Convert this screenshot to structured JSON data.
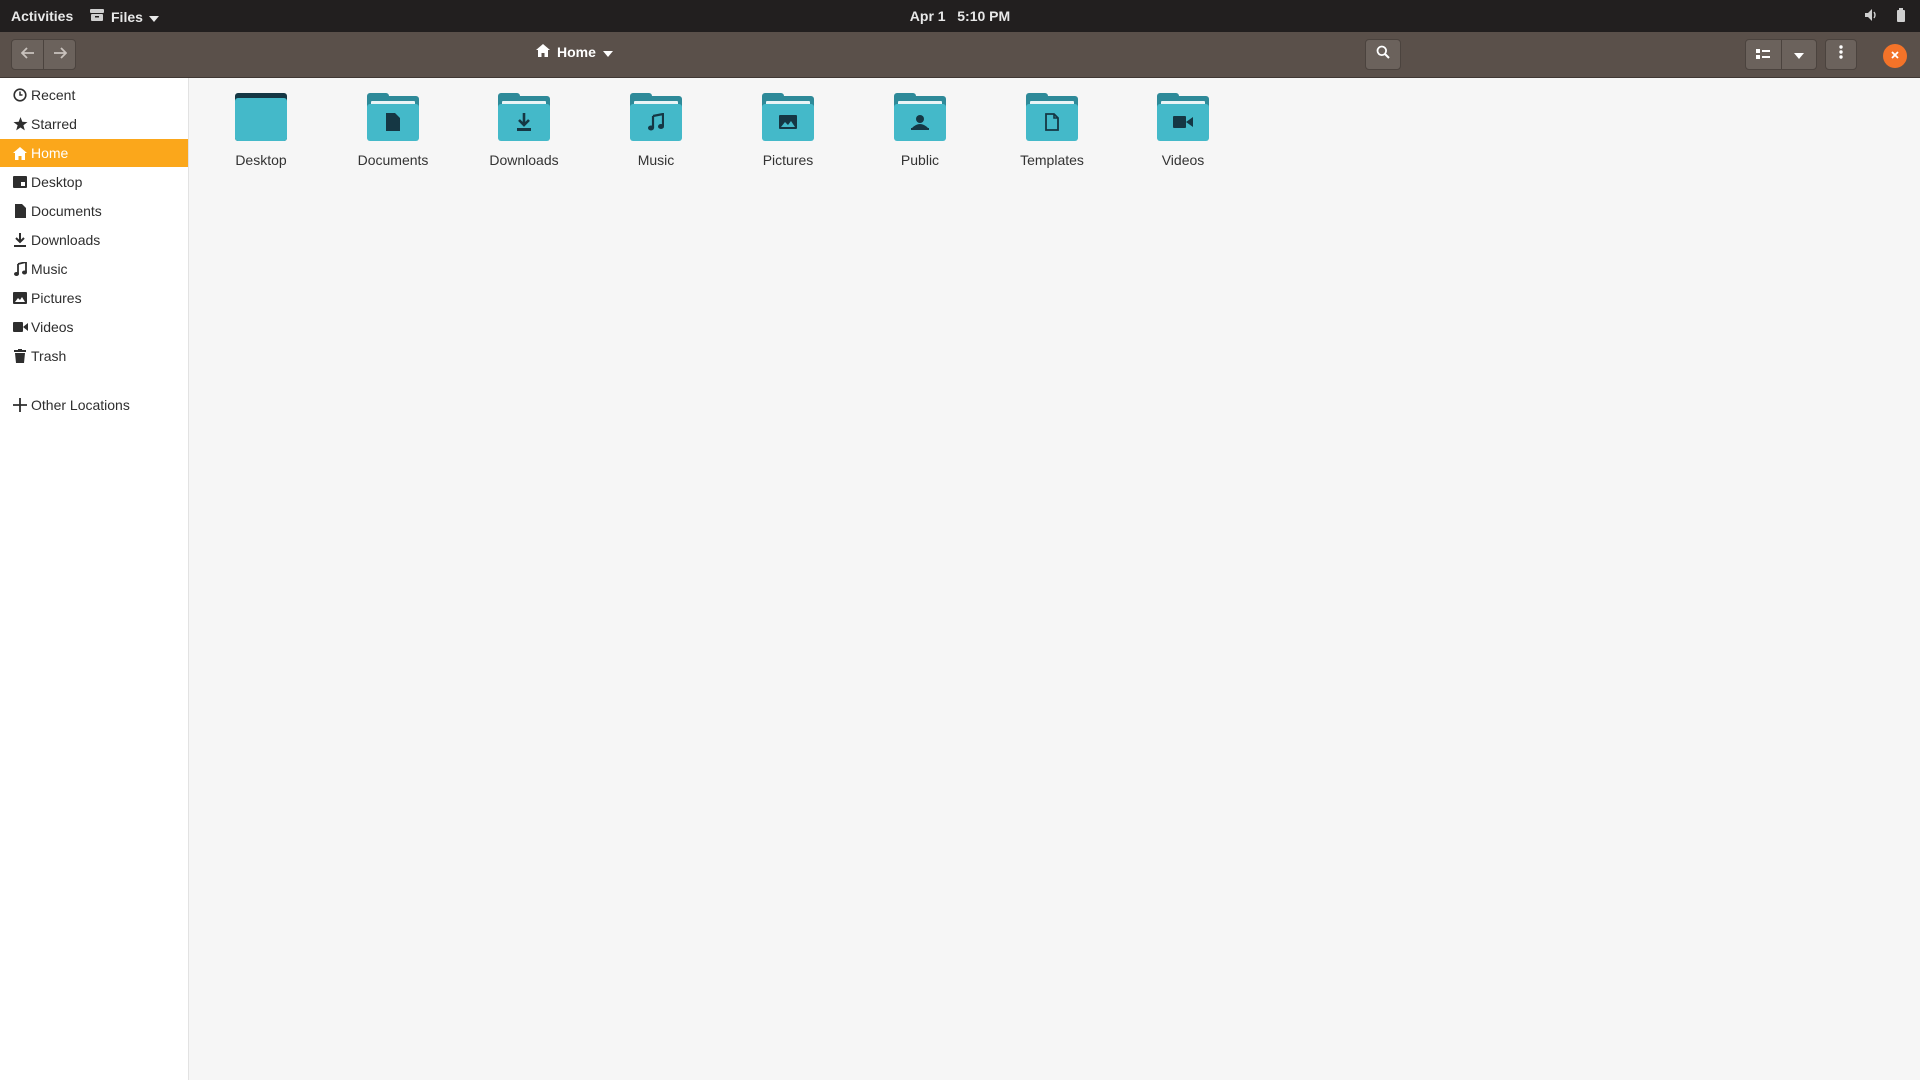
{
  "topbar": {
    "activities": "Activities",
    "app_name": "Files",
    "date": "Apr 1",
    "time": "5:10 PM",
    "icons": [
      "speaker-icon",
      "battery-icon"
    ]
  },
  "headerbar": {
    "back_icon": "arrow-left-icon",
    "forward_icon": "arrow-right-icon",
    "location": "Home",
    "search_icon": "search-icon",
    "view_icon": "list-view-icon",
    "view_menu_icon": "chevron-down-icon",
    "menu_icon": "kebab-menu-icon",
    "close_icon": "close-icon",
    "close_color": "#f37329"
  },
  "sidebar": {
    "accent": "#fba71b",
    "items": [
      {
        "label": "Recent",
        "icon": "clock-icon"
      },
      {
        "label": "Starred",
        "icon": "star-icon"
      },
      {
        "label": "Home",
        "icon": "home-icon",
        "active": true
      },
      {
        "label": "Desktop",
        "icon": "desktop-icon"
      },
      {
        "label": "Documents",
        "icon": "document-icon"
      },
      {
        "label": "Downloads",
        "icon": "download-icon"
      },
      {
        "label": "Music",
        "icon": "music-icon"
      },
      {
        "label": "Pictures",
        "icon": "picture-icon"
      },
      {
        "label": "Videos",
        "icon": "video-icon"
      },
      {
        "label": "Trash",
        "icon": "trash-icon"
      }
    ],
    "other": {
      "label": "Other Locations",
      "icon": "plus-icon"
    }
  },
  "main": {
    "folder_color": "#44b9c9",
    "folders": [
      {
        "label": "Desktop",
        "icon": "folder-desktop-icon"
      },
      {
        "label": "Documents",
        "icon": "folder-documents-icon"
      },
      {
        "label": "Downloads",
        "icon": "folder-downloads-icon"
      },
      {
        "label": "Music",
        "icon": "folder-music-icon"
      },
      {
        "label": "Pictures",
        "icon": "folder-pictures-icon"
      },
      {
        "label": "Public",
        "icon": "folder-public-icon"
      },
      {
        "label": "Templates",
        "icon": "folder-templates-icon"
      },
      {
        "label": "Videos",
        "icon": "folder-videos-icon"
      }
    ]
  }
}
